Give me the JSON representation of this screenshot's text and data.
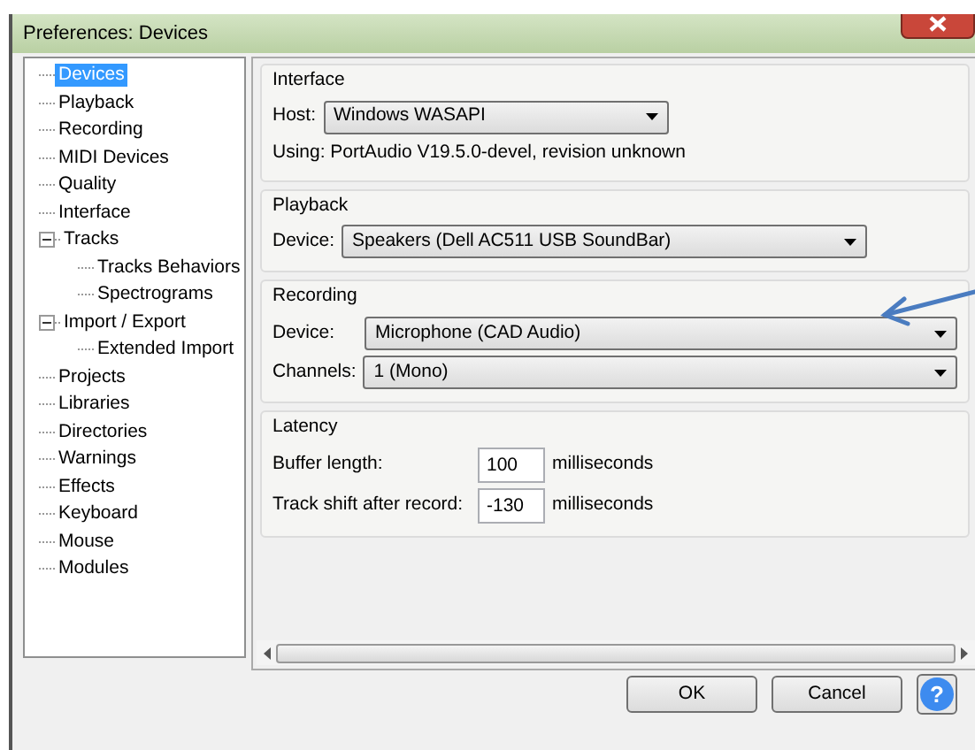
{
  "window": {
    "title": "Preferences: Devices"
  },
  "sidebar": {
    "items": [
      {
        "label": "Devices",
        "selected": true
      },
      {
        "label": "Playback",
        "selected": false
      },
      {
        "label": "Recording",
        "selected": false
      },
      {
        "label": "MIDI Devices",
        "selected": false
      },
      {
        "label": "Quality",
        "selected": false
      },
      {
        "label": "Interface",
        "selected": false
      },
      {
        "label": "Tracks",
        "selected": false,
        "expanded": true,
        "children": [
          {
            "label": "Tracks Behaviors",
            "selected": false
          },
          {
            "label": "Spectrograms",
            "selected": false
          }
        ]
      },
      {
        "label": "Import / Export",
        "selected": false,
        "expanded": true,
        "children": [
          {
            "label": "Extended Import",
            "selected": false
          }
        ]
      },
      {
        "label": "Projects",
        "selected": false
      },
      {
        "label": "Libraries",
        "selected": false
      },
      {
        "label": "Directories",
        "selected": false
      },
      {
        "label": "Warnings",
        "selected": false
      },
      {
        "label": "Effects",
        "selected": false
      },
      {
        "label": "Keyboard",
        "selected": false
      },
      {
        "label": "Mouse",
        "selected": false
      },
      {
        "label": "Modules",
        "selected": false
      }
    ]
  },
  "interface": {
    "title": "Interface",
    "host_label": "Host:",
    "host": "Windows WASAPI",
    "info": "Using: PortAudio V19.5.0-devel, revision unknown"
  },
  "playback": {
    "title": "Playback",
    "device_label": "Device:",
    "device": "Speakers (Dell AC511 USB SoundBar)"
  },
  "recording": {
    "title": "Recording",
    "device_label": "Device:",
    "device": "Microphone (CAD Audio)",
    "channels_label": "Channels:",
    "channels": "1 (Mono)"
  },
  "latency": {
    "title": "Latency",
    "rows": [
      {
        "label": "Buffer length:",
        "value": "100",
        "unit": "milliseconds"
      },
      {
        "label": "Track shift after record:",
        "value": "-130",
        "unit": "milliseconds"
      }
    ]
  },
  "buttons": [
    {
      "label": "OK"
    },
    {
      "label": "Cancel"
    }
  ],
  "help": "?"
}
